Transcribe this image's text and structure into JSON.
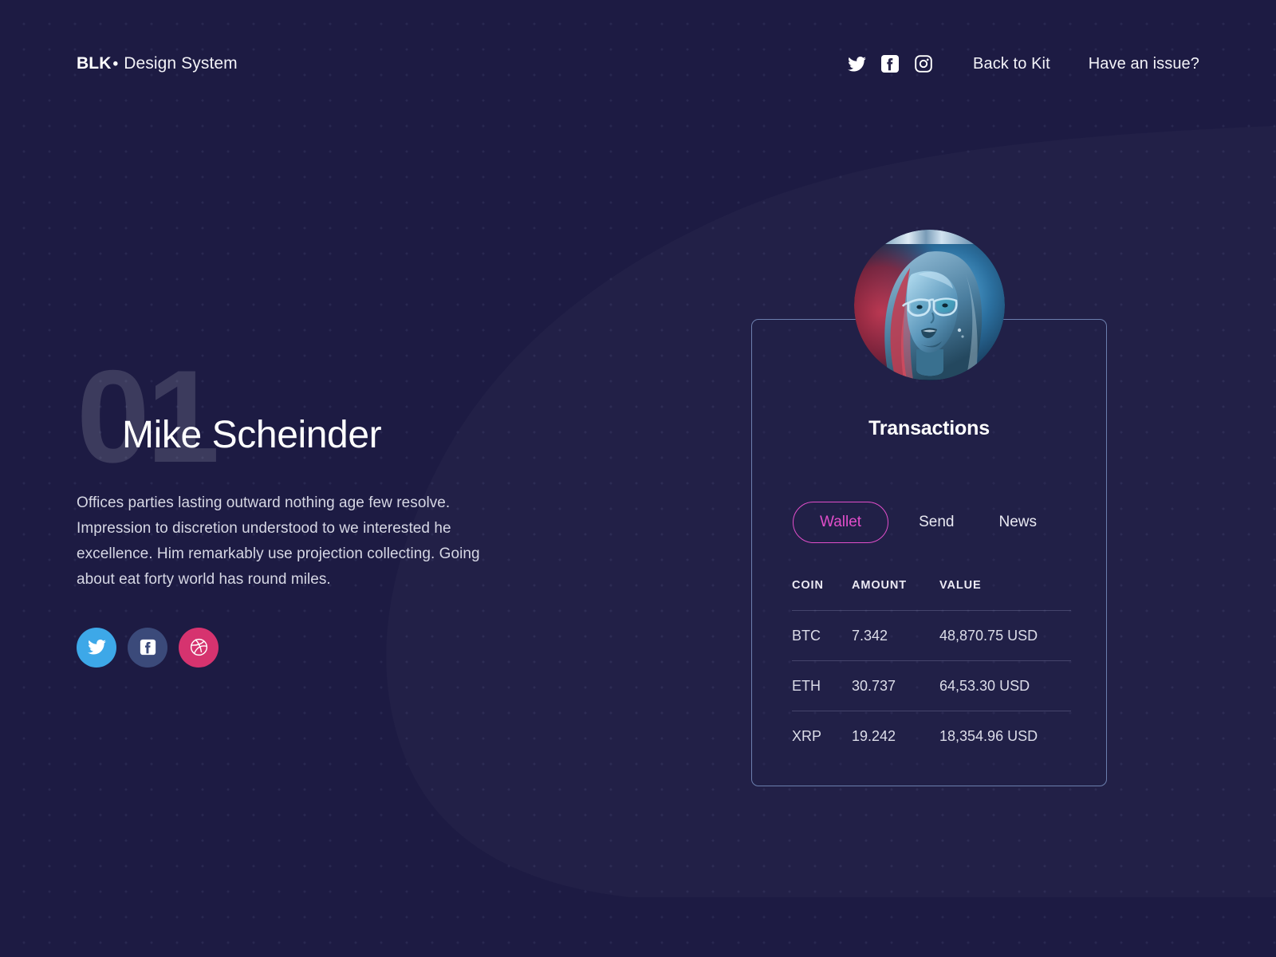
{
  "theme": {
    "background": "#1d1b43",
    "accent_pink": "#e14eca",
    "card_border": "#6c7fae",
    "text_primary": "#ffffff",
    "text_muted": "#d6d7e4"
  },
  "header": {
    "brand_strong": "BLK",
    "brand_dot": "•",
    "brand_rest": "Design System",
    "social_icons": [
      {
        "name": "twitter-icon",
        "label": "Twitter"
      },
      {
        "name": "facebook-icon",
        "label": "Facebook"
      },
      {
        "name": "instagram-icon",
        "label": "Instagram"
      }
    ],
    "links": [
      {
        "label": "Back to Kit"
      },
      {
        "label": "Have an issue?"
      }
    ]
  },
  "left": {
    "number": "01",
    "name": "Mike Scheinder",
    "bio": "Offices parties lasting outward nothing age few resolve. Impression to discretion understood to we interested he excellence. Him remarkably use projection collecting. Going about eat forty world has round miles.",
    "socials": [
      {
        "name": "twitter",
        "label": "Twitter",
        "color": "#3da8e8"
      },
      {
        "name": "facebook",
        "label": "Facebook",
        "color": "#3b4a7a"
      },
      {
        "name": "dribbble",
        "label": "Dribbble",
        "color": "#d6336f"
      }
    ]
  },
  "card": {
    "avatar_alt": "Portrait of a woman wearing glasses lit in blue and red",
    "title": "Transactions",
    "tabs": [
      {
        "label": "Wallet",
        "active": true
      },
      {
        "label": "Send",
        "active": false
      },
      {
        "label": "News",
        "active": false
      }
    ],
    "table": {
      "columns": [
        "COIN",
        "AMOUNT",
        "VALUE"
      ],
      "rows": [
        {
          "coin": "BTC",
          "amount": "7.342",
          "value": "48,870.75 USD"
        },
        {
          "coin": "ETH",
          "amount": "30.737",
          "value": "64,53.30 USD"
        },
        {
          "coin": "XRP",
          "amount": "19.242",
          "value": "18,354.96 USD"
        }
      ]
    }
  }
}
